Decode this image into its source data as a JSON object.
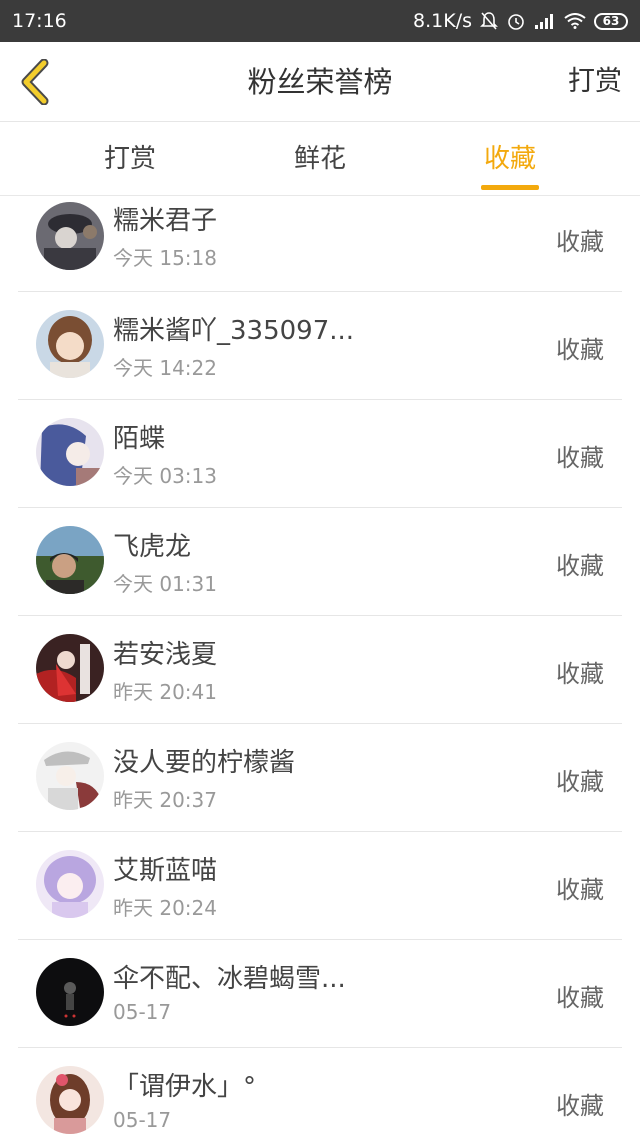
{
  "status_bar": {
    "time": "17:16",
    "network_speed": "8.1K/s",
    "battery": "63",
    "icons": [
      "mute-bell-icon",
      "alarm-icon",
      "signal-icon",
      "wifi-icon",
      "battery-icon"
    ]
  },
  "header": {
    "back_icon": "chevron-left-icon",
    "title": "粉丝荣誉榜",
    "action_label": "打赏"
  },
  "tabs": [
    {
      "label": "打赏",
      "active": false
    },
    {
      "label": "鲜花",
      "active": false
    },
    {
      "label": "收藏",
      "active": true
    }
  ],
  "colors": {
    "accent": "#f3a90d",
    "status_bar": "#3b3b3b",
    "text": "#444444",
    "subtext": "#999999"
  },
  "items": [
    {
      "name": "糯米君子",
      "time": "今天 15:18",
      "action": "收藏"
    },
    {
      "name": "糯米酱吖_335097...",
      "time": "今天 14:22",
      "action": "收藏"
    },
    {
      "name": "陌蝶",
      "time": "今天 03:13",
      "action": "收藏"
    },
    {
      "name": "飞虎龙",
      "time": "今天 01:31",
      "action": "收藏"
    },
    {
      "name": "若安浅夏",
      "time": "昨天 20:41",
      "action": "收藏"
    },
    {
      "name": "没人要的柠檬酱",
      "time": "昨天 20:37",
      "action": "收藏"
    },
    {
      "name": "艾斯蓝喵",
      "time": "昨天 20:24",
      "action": "收藏"
    },
    {
      "name": "伞不配、冰碧蝎雪...",
      "time": "05-17",
      "action": "收藏"
    },
    {
      "name": "「谓伊水」°",
      "time": "05-17",
      "action": "收藏"
    }
  ]
}
